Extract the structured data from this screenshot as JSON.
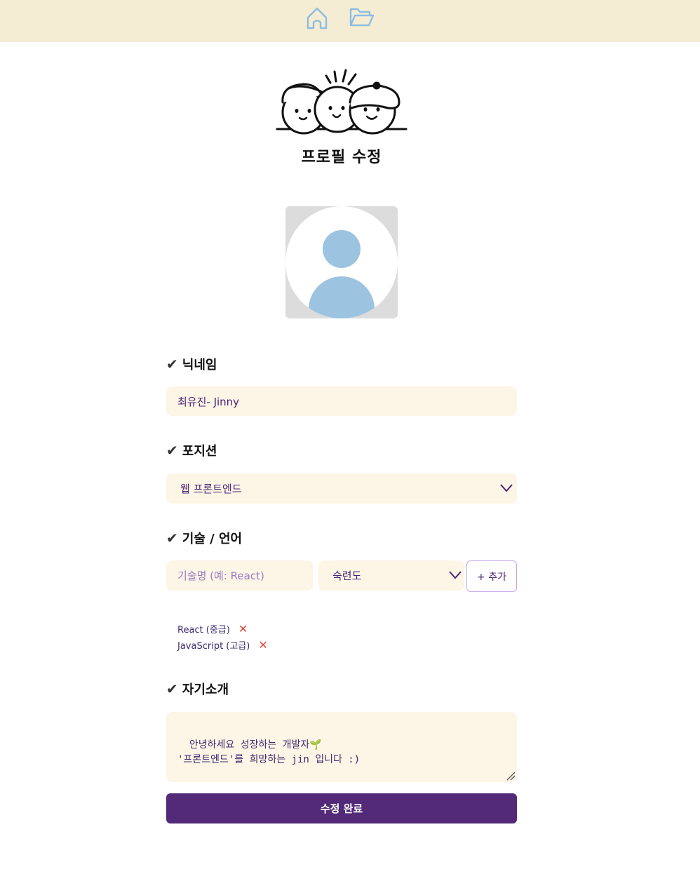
{
  "nav": {
    "home_icon": "home-icon",
    "folder_icon": "folder-open-icon"
  },
  "header": {
    "title": "프로필 수정"
  },
  "avatar": {
    "icon": "user-avatar-placeholder"
  },
  "sections": {
    "nickname_label": "닉네임",
    "position_label": "포지션",
    "skills_label": "기술 / 언어",
    "bio_label": "자기소개",
    "check_symbol": "✔"
  },
  "nickname": {
    "value": "최유진- Jinny"
  },
  "position": {
    "selected": "웹 프론트엔드"
  },
  "skill_input": {
    "placeholder": "기술명 (예: React)",
    "level_selected": "숙련도",
    "add_label": "+ 추가"
  },
  "skills": [
    {
      "label": "React (중급)"
    },
    {
      "label": "JavaScript (고급)"
    }
  ],
  "remove_symbol": "✕",
  "bio": {
    "value": "안녕하세요 성장하는 개발자🌱\n'프론트엔드'를 희망하는 jin 입니다 :)"
  },
  "submit": {
    "label": "수정 완료"
  },
  "colors": {
    "topbar": "#f5edd3",
    "field_bg": "#fdf5e6",
    "primary": "#522a78",
    "icon_blue": "#8fbde0"
  }
}
